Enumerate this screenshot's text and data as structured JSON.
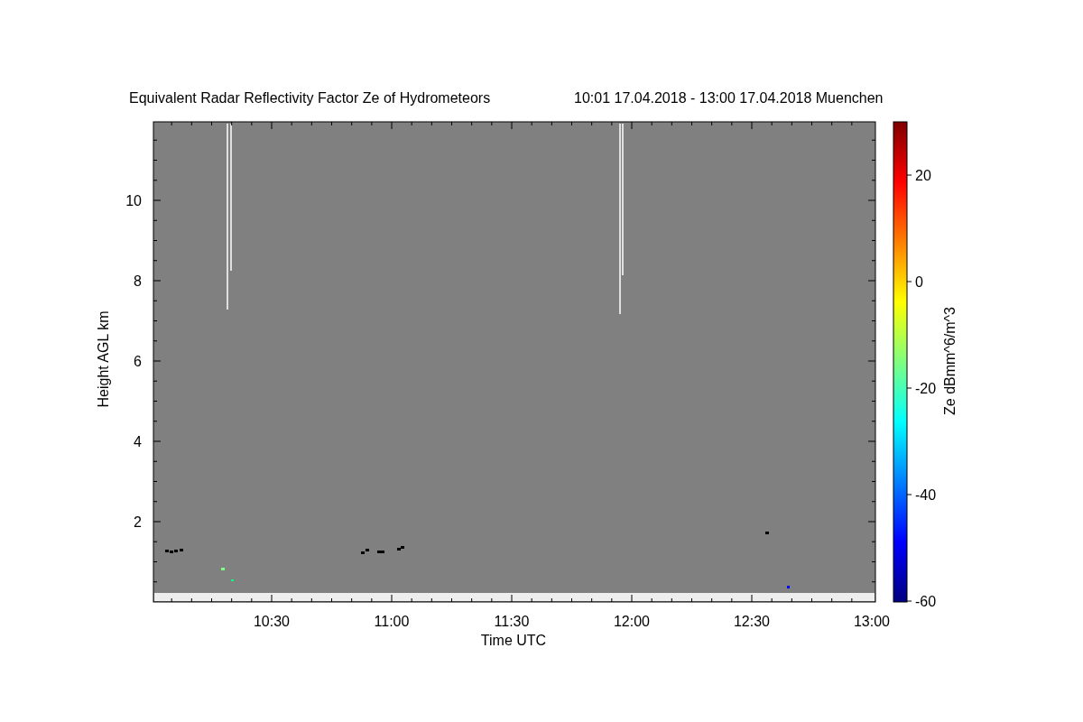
{
  "figure": {
    "title": "Equivalent Radar Reflectivity Factor Ze of Hydrometeors",
    "period": "10:01 17.04.2018 - 13:00 17.04.2018 Muenchen",
    "xlabel": "Time UTC",
    "ylabel": "Height AGL km",
    "xtick_labels": [
      "10:30",
      "11:00",
      "11:30",
      "12:00",
      "12:30",
      "13:00"
    ],
    "ytick_labels": [
      "10",
      "8",
      "6",
      "4",
      "2"
    ],
    "colorbar": {
      "label": "Ze dBmm^6/m^3",
      "tick_labels": [
        "20",
        "0",
        "-20",
        "-40",
        "-60"
      ]
    }
  }
}
